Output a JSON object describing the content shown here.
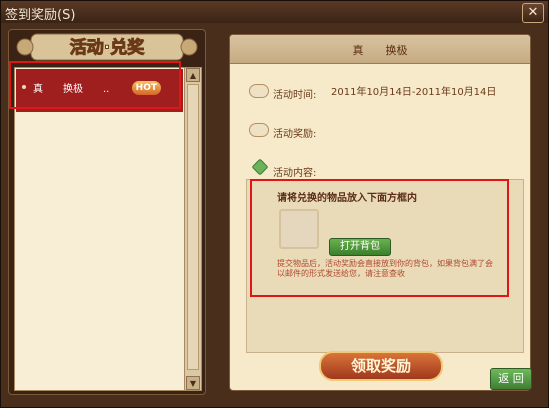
{
  "window": {
    "title": "签到奖励(S)",
    "close_label": "✕"
  },
  "left": {
    "header_title": "活动·兑奖",
    "items": [
      {
        "label": "真　　换极　　..",
        "badge": "HOT"
      }
    ]
  },
  "right": {
    "header_title": "真　　换极",
    "time_label": "活动时间:",
    "time_value": "2011年10月14日-2011年10月14日",
    "reward_label": "活动奖励:",
    "content_label": "活动内容:",
    "content_hint": "请将兑换的物品放入下面方框内",
    "open_bag_label": "打开背包",
    "note": "提交物品后，活动奖励会直接放到你的背包，如果背包满了会以邮件的形式发送给您，请注意查收"
  },
  "buttons": {
    "claim_label": "领取奖励",
    "back_label": "返 回"
  },
  "colors": {
    "highlight": "#e01616",
    "panel": "#f6eacb",
    "frame": "#4a2e1c"
  },
  "icons": [
    "close-icon",
    "clock-icon",
    "scroll-icon",
    "leaf-icon"
  ]
}
